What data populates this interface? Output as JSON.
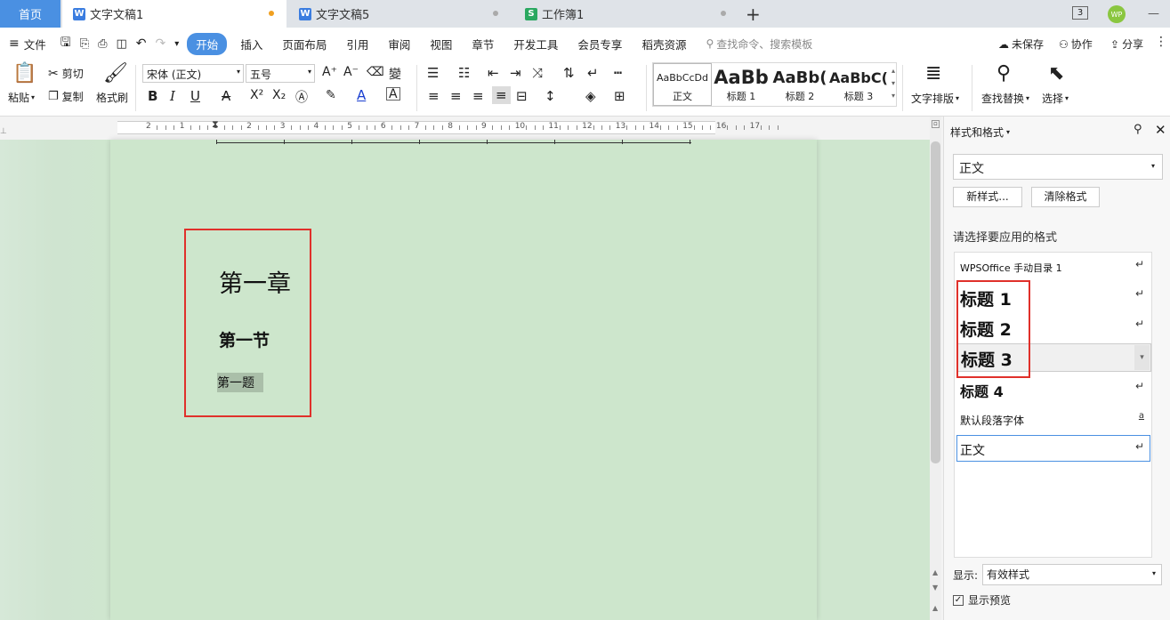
{
  "tabs": {
    "home": "首页",
    "doc1": "文字文稿1",
    "doc5": "文字文稿5",
    "sheet1": "工作簿1",
    "add": "+"
  },
  "window": {
    "badge_count": "3",
    "avatar": "WP"
  },
  "menu": {
    "file": "文件",
    "items": [
      "开始",
      "插入",
      "页面布局",
      "引用",
      "审阅",
      "视图",
      "章节",
      "开发工具",
      "会员专享",
      "稻壳资源"
    ],
    "search_placeholder": "查找命令、搜索模板",
    "unsaved": "未保存",
    "collab": "协作",
    "share": "分享"
  },
  "ribbon": {
    "paste": "粘贴",
    "cut": "剪切",
    "copy": "复制",
    "format_painter": "格式刷",
    "font_name": "宋体 (正文)",
    "font_size": "五号",
    "styles": [
      {
        "preview": "AaBbCcDd",
        "name": "正文"
      },
      {
        "preview": "AaBb",
        "name": "标题 1"
      },
      {
        "preview": "AaBb(",
        "name": "标题 2"
      },
      {
        "preview": "AaBbC(",
        "name": "标题 3"
      }
    ],
    "text_layout": "文字排版",
    "find_replace": "查找替换",
    "select": "选择"
  },
  "ruler": {
    "ticks": [
      "2",
      "1",
      "1",
      "2",
      "3",
      "4",
      "5",
      "6",
      "7",
      "8",
      "9",
      "10",
      "11",
      "12",
      "13",
      "14",
      "15",
      "16",
      "17"
    ]
  },
  "document": {
    "chapter": "第一章",
    "section": "第一节",
    "question": "第一题"
  },
  "panel": {
    "title": "样式和格式",
    "current_style": "正文",
    "new_style": "新样式...",
    "clear_format": "清除格式",
    "apply_label": "请选择要应用的格式",
    "list": [
      {
        "label": "WPSOffice 手动目录 1",
        "mark": "↵"
      },
      {
        "label": "标题 1",
        "mark": "↵"
      },
      {
        "label": "标题 2",
        "mark": "↵"
      },
      {
        "label": "标题 3",
        "mark": "▾"
      },
      {
        "label": "标题 4",
        "mark": "↵"
      },
      {
        "label": "默认段落字体",
        "mark": "a"
      },
      {
        "label": "正文",
        "mark": "↵"
      }
    ],
    "show_label": "显示:",
    "show_value": "有效样式",
    "preview_label": "显示预览"
  },
  "colors": {
    "accent": "#4a90e2",
    "highlight_red": "#e0302a",
    "page_bg": "#cde6cc"
  }
}
